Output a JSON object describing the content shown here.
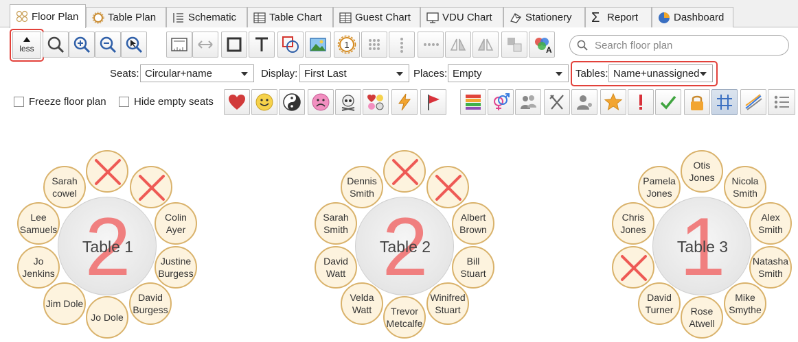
{
  "tabs": [
    {
      "label": "Floor Plan",
      "icon": "floor-plan-icon",
      "active": true
    },
    {
      "label": "Table Plan",
      "icon": "table-plan-icon"
    },
    {
      "label": "Schematic",
      "icon": "schematic-icon"
    },
    {
      "label": "Table Chart",
      "icon": "table-chart-icon"
    },
    {
      "label": "Guest Chart",
      "icon": "guest-chart-icon"
    },
    {
      "label": "VDU Chart",
      "icon": "monitor-icon"
    },
    {
      "label": "Stationery",
      "icon": "stationery-icon"
    },
    {
      "label": "Report",
      "icon": "sigma-icon"
    },
    {
      "label": "Dashboard",
      "icon": "pie-icon"
    }
  ],
  "toolbar": {
    "less_label": "less",
    "search_placeholder": "Search floor plan"
  },
  "options": {
    "seats_label": "Seats:",
    "seats_value": "Circular+name",
    "display_label": "Display:",
    "display_value": "First Last",
    "places_label": "Places:",
    "places_value": "Empty",
    "tables_label": "Tables:",
    "tables_value": "Name+unassigned",
    "freeze_label": "Freeze floor plan",
    "hide_empty_label": "Hide empty seats"
  },
  "colors": {
    "highlight": "#e2413a",
    "seat_fill": "#fdf3de",
    "seat_border": "#d9b26b",
    "empty_cross": "#ee5a55",
    "unassigned_count": "#f07f7f"
  },
  "tables": [
    {
      "name": "Table 1",
      "unassigned": "2",
      "seats": [
        "",
        "",
        "Colin Ayer",
        "Justine Burgess",
        "David Burgess",
        "Jo Dole",
        "Jim Dole",
        "Jo Jenkins",
        "Lee Samuels",
        "Sarah cowel"
      ]
    },
    {
      "name": "Table 2",
      "unassigned": "2",
      "seats": [
        "",
        "",
        "Albert Brown",
        "Bill Stuart",
        "Winifred Stuart",
        "Trevor Metcalfe",
        "Velda Watt",
        "David Watt",
        "Sarah Smith",
        "Dennis Smith"
      ]
    },
    {
      "name": "Table 3",
      "unassigned": "1",
      "seats": [
        "Otis Jones",
        "Nicola Smith",
        "Alex Smith",
        "Natasha Smith",
        "Mike Smythe",
        "Rose Atwell",
        "David Turner",
        "",
        "Chris Jones",
        "Pamela Jones"
      ]
    }
  ]
}
